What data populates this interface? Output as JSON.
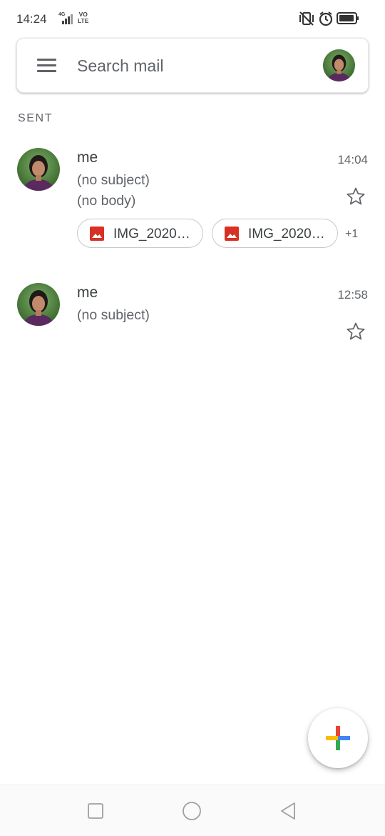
{
  "status_bar": {
    "time": "14:24",
    "network": "4G",
    "volte_top": "VO",
    "volte_bottom": "LTE"
  },
  "search": {
    "placeholder": "Search mail"
  },
  "section": {
    "label": "SENT"
  },
  "mails": [
    {
      "sender": "me",
      "subject": "(no subject)",
      "snippet": "(no body)",
      "time": "14:04",
      "starred": false,
      "attachments": [
        "IMG_2020…",
        "IMG_2020…"
      ],
      "more_attachments": "+1"
    },
    {
      "sender": "me",
      "subject": "(no subject)",
      "time": "12:58",
      "starred": false
    }
  ],
  "colors": {
    "attachment_icon": "#d93025",
    "accent_blue": "#4285f4",
    "accent_red": "#ea4335",
    "accent_yellow": "#fbbc04",
    "accent_green": "#34a853"
  },
  "icons": {
    "menu": "hamburger-menu-icon",
    "star": "star-outline-icon",
    "attachment": "image-icon",
    "compose": "compose-plus-icon",
    "vibrate": "vibrate-off-icon",
    "alarm": "alarm-icon",
    "battery": "battery-icon"
  }
}
